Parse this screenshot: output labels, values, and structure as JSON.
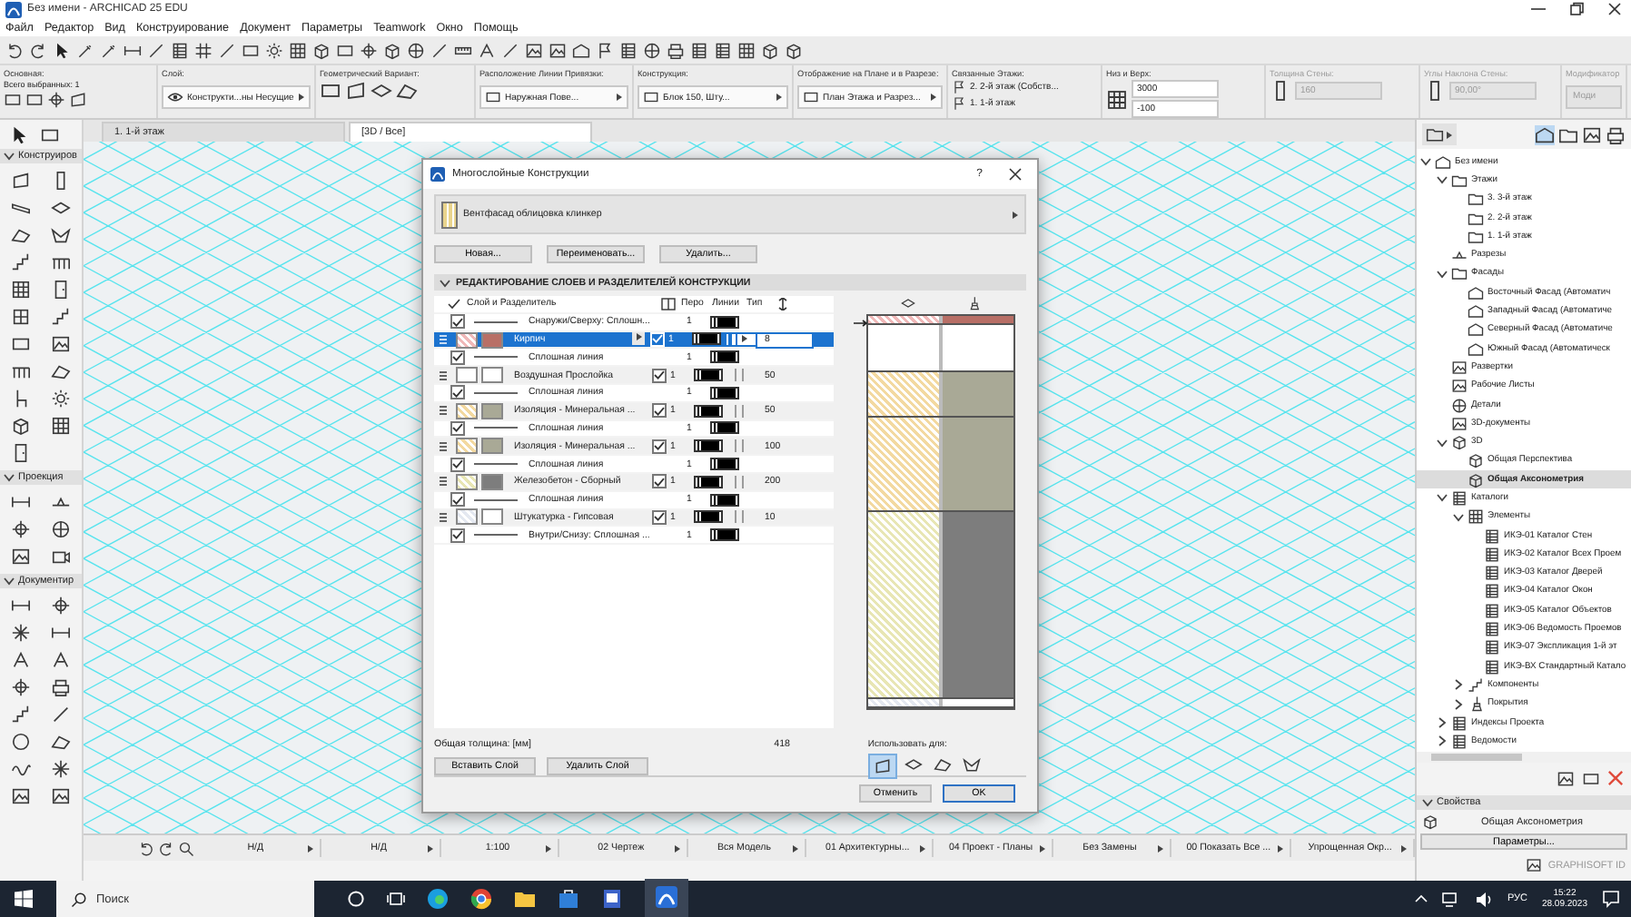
{
  "window": {
    "title": "Без имени - ARCHICAD 25 EDU"
  },
  "menu": [
    "Файл",
    "Редактор",
    "Вид",
    "Конструирование",
    "Документ",
    "Параметры",
    "Teamwork",
    "Окно",
    "Помощь"
  ],
  "info_box": [
    {
      "label": "Основная:",
      "kind": "selection",
      "disabled": false,
      "values": [
        "Всего выбранных: 1"
      ]
    },
    {
      "label": "Слой:",
      "kind": "dropdown",
      "disabled": false,
      "values": [
        "Конструкти...ны Несущие"
      ]
    },
    {
      "label": "Геометрический Вариант:",
      "kind": "icons",
      "disabled": false
    },
    {
      "label": "Расположение Линии Привязки:",
      "kind": "dropdown",
      "disabled": false,
      "values": [
        "Наружная Пове..."
      ]
    },
    {
      "label": "Конструкция:",
      "kind": "dropdown",
      "disabled": false,
      "values": [
        "Блок 150, Шту..."
      ]
    },
    {
      "label": "Отображение на Плане и в Разрезе:",
      "kind": "dropdown",
      "disabled": false,
      "values": [
        "План Этажа и Разрез..."
      ]
    },
    {
      "label": "Связанные Этажи:",
      "kind": "stack",
      "disabled": false,
      "values": [
        "2. 2-й этаж (Собств...",
        "1. 1-й этаж"
      ]
    },
    {
      "label": "Низ и Верх:",
      "kind": "fields",
      "disabled": false,
      "values": [
        "3000",
        "-100"
      ]
    },
    {
      "label": "Толщина Стены:",
      "kind": "fields",
      "disabled": true,
      "values": [
        "160"
      ]
    },
    {
      "label": "Углы Наклона Стены:",
      "kind": "fields",
      "disabled": true,
      "values": [
        "90,00°"
      ]
    },
    {
      "label": "Модификатор",
      "kind": "button",
      "disabled": true,
      "values": [
        "Моди"
      ]
    }
  ],
  "tabs": [
    {
      "label": "1. 1-й этаж",
      "selected": false
    },
    {
      "label": "[3D / Все]",
      "selected": true
    }
  ],
  "toolbox": [
    {
      "label": "Конструиров",
      "expanded": true
    },
    {
      "label": "Проекция",
      "expanded": true
    },
    {
      "label": "Документир",
      "expanded": true
    }
  ],
  "dialog": {
    "title": "Многослойные Конструкции",
    "help": "?",
    "composite": "Вентфасад облицовка клинкер",
    "buttons": [
      "Новая...",
      "Переименовать...",
      "Удалить..."
    ],
    "section": {
      "label": "РЕДАКТИРОВАНИЕ СЛОЕВ И РАЗДЕЛИТЕЛЕЙ КОНСТРУКЦИИ",
      "expanded": true
    },
    "columns": [
      "Слой и Разделитель",
      "Перо",
      "Линии",
      "Тип"
    ],
    "rows": [
      {
        "kind": "line",
        "selected": false,
        "checked": true,
        "name": "Снаружи/Сверху: Сплошн...",
        "pen": "1"
      },
      {
        "kind": "layer",
        "selected": true,
        "name": "Кирпич",
        "swatches": [
          {
            "color": "#f0b8b8"
          },
          {
            "color": "#b86f66"
          }
        ],
        "core": true,
        "pen": "1",
        "thickness": "8"
      },
      {
        "kind": "line",
        "selected": false,
        "checked": true,
        "name": "Сплошная линия",
        "pen": "1"
      },
      {
        "kind": "layer",
        "selected": false,
        "name": "Воздушная Прослойка",
        "swatches": [
          {
            "color": "#ffffff"
          },
          {
            "color": "#ffffff"
          }
        ],
        "core": true,
        "pen": "1",
        "thickness": "50"
      },
      {
        "kind": "line",
        "selected": false,
        "checked": true,
        "name": "Сплошная линия",
        "pen": "1"
      },
      {
        "kind": "layer",
        "selected": false,
        "name": "Изоляция - Минеральная ...",
        "swatches": [
          {
            "color": "#f3d9a0"
          },
          {
            "color": "#a9a996"
          }
        ],
        "core": true,
        "pen": "1",
        "thickness": "50"
      },
      {
        "kind": "line",
        "selected": false,
        "checked": true,
        "name": "Сплошная линия",
        "pen": "1"
      },
      {
        "kind": "layer",
        "selected": false,
        "name": "Изоляция - Минеральная ...",
        "swatches": [
          {
            "color": "#f3d9a0"
          },
          {
            "color": "#a9a996"
          }
        ],
        "core": true,
        "pen": "1",
        "thickness": "100"
      },
      {
        "kind": "line",
        "selected": false,
        "checked": true,
        "name": "Сплошная линия",
        "pen": "1"
      },
      {
        "kind": "layer",
        "selected": false,
        "name": "Железобетон - Сборный",
        "swatches": [
          {
            "color": "#e8e6b4"
          },
          {
            "color": "#7d7d7d"
          }
        ],
        "core": true,
        "pen": "1",
        "thickness": "200"
      },
      {
        "kind": "line",
        "selected": false,
        "checked": true,
        "name": "Сплошная линия",
        "pen": "1"
      },
      {
        "kind": "layer",
        "selected": false,
        "name": "Штукатурка - Гипсовая",
        "swatches": [
          {
            "color": "#e4e8f0"
          },
          {
            "color": "#ffffff"
          }
        ],
        "core": true,
        "pen": "1",
        "thickness": "10"
      },
      {
        "kind": "line",
        "selected": false,
        "checked": true,
        "name": "Внутри/Снизу: Сплошная ...",
        "pen": "1"
      }
    ],
    "total_label": "Общая толщина: [мм]",
    "total": "418",
    "row_buttons": [
      "Вставить Слой",
      "Удалить Слой"
    ],
    "use_for": {
      "label": "Использовать для:",
      "options": [
        {
          "kind": "wall",
          "selected": true
        },
        {
          "kind": "slab",
          "selected": false
        },
        {
          "kind": "roof",
          "selected": false
        },
        {
          "kind": "shell",
          "selected": false
        }
      ]
    },
    "cancel": "Отменить",
    "ok": "OK"
  },
  "navigator": {
    "tree": [
      {
        "label": "Без имени",
        "kind": "project",
        "expanded": true,
        "selected": false,
        "children": [
          {
            "label": "Этажи",
            "kind": "folder",
            "expanded": true,
            "selected": false,
            "children": [
              {
                "label": "3. 3-й этаж",
                "kind": "story",
                "selected": false
              },
              {
                "label": "2. 2-й этаж",
                "kind": "story",
                "selected": false
              },
              {
                "label": "1. 1-й этаж",
                "kind": "story",
                "selected": false
              }
            ]
          },
          {
            "label": "Разрезы",
            "kind": "sections",
            "selected": false
          },
          {
            "label": "Фасады",
            "kind": "folder",
            "expanded": true,
            "selected": false,
            "children": [
              {
                "label": "Восточный Фасад (Автоматич",
                "kind": "elevation",
                "selected": false
              },
              {
                "label": "Западный Фасад (Автоматиче",
                "kind": "elevation",
                "selected": false
              },
              {
                "label": "Северный Фасад (Автоматиче",
                "kind": "elevation",
                "selected": false
              },
              {
                "label": "Южный Фасад (Автоматическ",
                "kind": "elevation",
                "selected": false
              }
            ]
          },
          {
            "label": "Развертки",
            "kind": "worksheet",
            "selected": false
          },
          {
            "label": "Рабочие Листы",
            "kind": "image",
            "selected": false
          },
          {
            "label": "Детали",
            "kind": "detail",
            "selected": false
          },
          {
            "label": "3D-документы",
            "kind": "worksheet",
            "selected": false
          },
          {
            "label": "3D",
            "kind": "cube",
            "expanded": true,
            "selected": false,
            "children": [
              {
                "label": "Общая Перспектива",
                "kind": "cube",
                "selected": false
              },
              {
                "label": "Общая Аксонометрия",
                "kind": "cube",
                "selected": true
              }
            ]
          },
          {
            "label": "Каталоги",
            "kind": "table",
            "expanded": true,
            "selected": false,
            "children": [
              {
                "label": "Элементы",
                "kind": "elements",
                "expanded": true,
                "selected": false,
                "children": [
                  {
                    "label": "ИКЭ-01 Каталог Стен",
                    "kind": "table",
                    "selected": false
                  },
                  {
                    "label": "ИКЭ-02 Каталог Всех Проем",
                    "kind": "table",
                    "selected": false
                  },
                  {
                    "label": "ИКЭ-03 Каталог Дверей",
                    "kind": "table",
                    "selected": false
                  },
                  {
                    "label": "ИКЭ-04 Каталог Окон",
                    "kind": "table",
                    "selected": false
                  },
                  {
                    "label": "ИКЭ-05 Каталог Объектов",
                    "kind": "table",
                    "selected": false
                  },
                  {
                    "label": "ИКЭ-06 Ведомость Проемов",
                    "kind": "table",
                    "selected": false
                  },
                  {
                    "label": "ИКЭ-07 Экспликация 1-й эт",
                    "kind": "table",
                    "selected": false
                  },
                  {
                    "label": "ИКЭ-ВХ Стандартный Катало",
                    "kind": "table",
                    "selected": false
                  }
                ]
              },
              {
                "label": "Компоненты",
                "kind": "components",
                "expanded": false,
                "selected": false
              },
              {
                "label": "Покрытия",
                "kind": "surfaces",
                "expanded": false,
                "selected": false
              }
            ]
          },
          {
            "label": "Индексы Проекта",
            "kind": "index",
            "expanded": false,
            "selected": false
          },
          {
            "label": "Ведомости",
            "kind": "list",
            "expanded": false,
            "selected": false
          }
        ]
      }
    ]
  },
  "properties": {
    "label": "Свойства",
    "expanded": true,
    "view": "Общая Аксонометрия",
    "button": "Параметры..."
  },
  "graphisoft_id": "GRAPHISOFT ID",
  "status_bar": [
    "Н/Д",
    "Н/Д",
    "1:100",
    "02 Чертеж",
    "Вся Модель",
    "01 Архитектурны...",
    "04 Проект - Планы",
    "Без Замены",
    "00 Показать Все ...",
    "Упрощенная Окр..."
  ],
  "taskbar": {
    "search_placeholder": "Поиск",
    "language": "РУС",
    "time": "15:22",
    "date": "28.09.2023"
  }
}
